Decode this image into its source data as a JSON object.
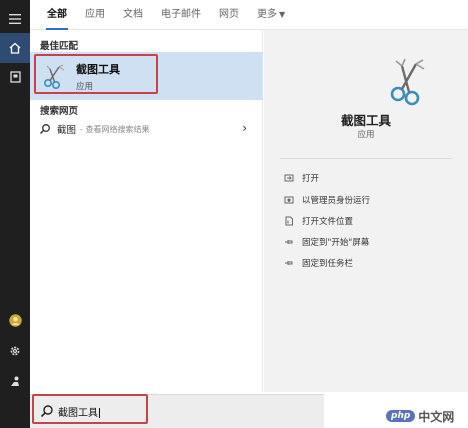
{
  "tabs": [
    {
      "label": "全部",
      "active": true
    },
    {
      "label": "应用",
      "active": false
    },
    {
      "label": "文档",
      "active": false
    },
    {
      "label": "电子邮件",
      "active": false
    },
    {
      "label": "网页",
      "active": false
    },
    {
      "label": "更多",
      "active": false
    }
  ],
  "left": {
    "best_match_heading": "最佳匹配",
    "best_match": {
      "title": "截图工具",
      "subtitle": "应用"
    },
    "web_heading": "搜索网页",
    "web_result": {
      "term": "截图",
      "desc": "- 查看网络搜索结果"
    }
  },
  "right": {
    "app_title": "截图工具",
    "app_type": "应用",
    "actions": [
      {
        "label": "打开"
      },
      {
        "label": "以管理员身份运行"
      },
      {
        "label": "打开文件位置"
      },
      {
        "label": "固定到\"开始\"屏幕"
      },
      {
        "label": "固定到任务栏"
      }
    ]
  },
  "search": {
    "query": "截图工具"
  },
  "watermark": {
    "badge": "php",
    "text": "中文网"
  },
  "colors": {
    "rail": "#1f1f1f",
    "active_rail": "#2f4b72",
    "selection": "#cfe0f3",
    "highlight_box": "#c8424b",
    "accent": "#2f6fcf"
  }
}
